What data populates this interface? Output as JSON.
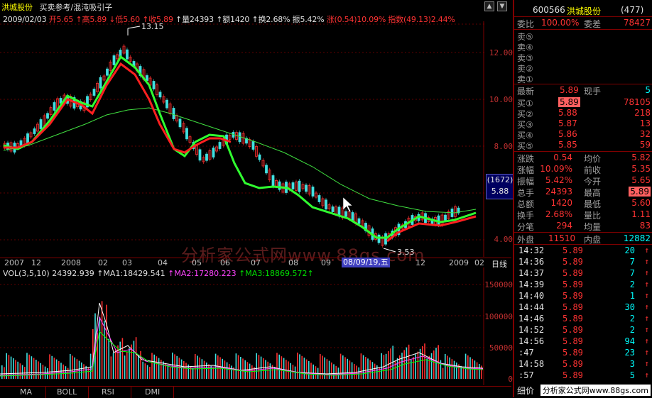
{
  "title_bar": {
    "stock_name": "洪城股份",
    "indicator_1": "买卖参考",
    "indicator_2": "混沌吸引子"
  },
  "info_line": {
    "date": "2009/02/03",
    "open_label": "开",
    "open": "5.65",
    "high_label": "高",
    "high": "5.89",
    "low_label": "低",
    "low": "5.60",
    "close_label": "收",
    "close": "5.89",
    "volume_label": "量",
    "volume": "24393",
    "amount_label": "额",
    "amount": "1420",
    "turnover_label": "换",
    "turnover": "2.68%",
    "amplitude_label": "振",
    "amplitude": "5.42%",
    "change_label": "涨",
    "change": "(0.54)10.09%",
    "index_label": "指数",
    "index": "(49.13)2.44%"
  },
  "price_axis": [
    "12.00",
    "10.00",
    "8.00",
    "4.00"
  ],
  "peak_label": "13.15",
  "trough_label": "3.53",
  "price_box": {
    "line1": "(1672)",
    "line2": "5.88"
  },
  "x_axis": [
    "2007",
    "12",
    "2008",
    "02",
    "03",
    "04",
    "05",
    "06",
    "07",
    "08",
    "09",
    "12",
    "2009",
    "02"
  ],
  "date_tag": "08/09/19,五",
  "period_label": "日线",
  "watermark": "分析家公式网www.88gs.com",
  "vol_info": {
    "label": "VOL(3,5,10)",
    "value": "24392.939",
    "ma1": "MA1:18429.541",
    "ma2": "MA2:17280.223",
    "ma3": "MA3:18869.572"
  },
  "vol_axis": [
    "150000",
    "100000",
    "50000",
    "0"
  ],
  "bottom_tabs": [
    "MA",
    "BOLL",
    "RSI",
    "DMI"
  ],
  "panel": {
    "code": "600566",
    "name": "洪城股份",
    "rank": "(477)",
    "weibi_label": "委比",
    "weibi": "100.00%",
    "weicha_label": "委差",
    "weicha": "78427",
    "sell": [
      {
        "label": "卖⑤",
        "price": "",
        "vol": ""
      },
      {
        "label": "卖④",
        "price": "",
        "vol": ""
      },
      {
        "label": "卖③",
        "price": "",
        "vol": ""
      },
      {
        "label": "卖②",
        "price": "",
        "vol": ""
      },
      {
        "label": "卖①",
        "price": "",
        "vol": ""
      }
    ],
    "latest_label": "最新",
    "latest": "5.89",
    "xianshou_label": "现手",
    "xianshou": "5",
    "buy": [
      {
        "label": "买①",
        "price": "5.89",
        "vol": "78105"
      },
      {
        "label": "买②",
        "price": "5.88",
        "vol": "218"
      },
      {
        "label": "买③",
        "price": "5.87",
        "vol": "13"
      },
      {
        "label": "买④",
        "price": "5.86",
        "vol": "32"
      },
      {
        "label": "买⑤",
        "price": "5.85",
        "vol": "59"
      }
    ],
    "stats": [
      {
        "l1": "涨跌",
        "v1": "0.54",
        "l2": "均价",
        "v2": "5.82"
      },
      {
        "l1": "涨幅",
        "v1": "10.09%",
        "l2": "前收",
        "v2": "5.35"
      },
      {
        "l1": "振幅",
        "v1": "5.42%",
        "l2": "今开",
        "v2": "5.65"
      },
      {
        "l1": "总手",
        "v1": "24393",
        "l2": "最高",
        "v2": "5.89"
      },
      {
        "l1": "总额",
        "v1": "1420",
        "l2": "最低",
        "v2": "5.60"
      },
      {
        "l1": "换手",
        "v1": "2.68%",
        "l2": "量比",
        "v2": "1.11"
      },
      {
        "l1": "分笔",
        "v1": "294",
        "l2": "均量",
        "v2": "83"
      }
    ],
    "waipan_label": "外盘",
    "waipan": "11510",
    "neipan_label": "内盘",
    "neipan": "12882",
    "ticks": [
      {
        "time": "14:32",
        "price": "5.89",
        "vol": "20"
      },
      {
        "time": "14:36",
        "price": "5.89",
        "vol": "7"
      },
      {
        "time": "14:37",
        "price": "5.89",
        "vol": "7"
      },
      {
        "time": "14:39",
        "price": "5.89",
        "vol": "2"
      },
      {
        "time": "14:40",
        "price": "5.89",
        "vol": "1"
      },
      {
        "time": "14:44",
        "price": "5.89",
        "vol": "30"
      },
      {
        "time": "14:46",
        "price": "5.89",
        "vol": "2"
      },
      {
        "time": "14:52",
        "price": "5.89",
        "vol": "2"
      },
      {
        "time": "14:56",
        "price": "5.89",
        "vol": "94"
      },
      {
        "time": ":47",
        "price": "5.89",
        "vol": "23"
      },
      {
        "time": "14:58",
        "price": "5.89",
        "vol": "3"
      },
      {
        "time": ":57",
        "price": "5.89",
        "vol": "5"
      }
    ],
    "detail_label": "细价",
    "footer_watermark": "分析家公式网www.88gs.com"
  },
  "colors": {
    "up": "#ff3333",
    "down": "#00ffff",
    "ma_fast": "#ff2020",
    "ma_slow": "#30ff30",
    "ma_long": "#40e040",
    "border": "#800000"
  }
}
